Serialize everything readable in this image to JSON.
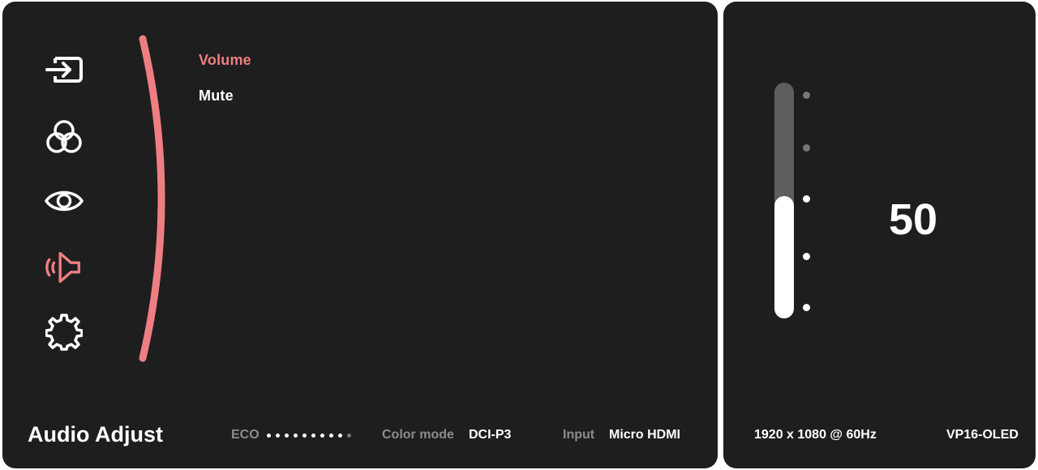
{
  "menu": {
    "items": [
      {
        "label": "Volume",
        "active": true
      },
      {
        "label": "Mute",
        "active": false
      }
    ]
  },
  "sidebar_icons": [
    "input-icon",
    "color-icon",
    "eye-icon",
    "audio-icon",
    "gear-icon"
  ],
  "active_icon": "audio-icon",
  "footer": {
    "title": "Audio Adjust",
    "eco_label": "ECO",
    "eco_level": 9,
    "eco_max": 10,
    "color_mode_label": "Color mode",
    "color_mode_value": "DCI-P3",
    "input_label": "Input",
    "input_value": "Micro HDMI"
  },
  "volume": {
    "value": "50",
    "fraction": 0.52
  },
  "info": {
    "resolution": "1920 x 1080 @ 60Hz",
    "model": "VP16-OLED"
  },
  "colors": {
    "accent": "#ef7e82",
    "panel": "#1e1e1f",
    "text": "#ffffff",
    "muted": "#8c8c8c"
  }
}
